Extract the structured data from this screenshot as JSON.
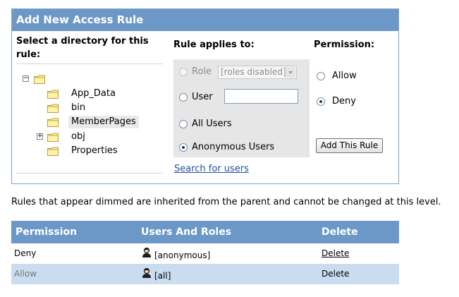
{
  "panel": {
    "title": "Add New Access Rule",
    "directory": {
      "title": "Select a directory for this rule:",
      "tree": [
        {
          "label": "",
          "expand": "minus"
        },
        {
          "label": "App_Data"
        },
        {
          "label": "bin"
        },
        {
          "label": "MemberPages",
          "selected": true
        },
        {
          "label": "obj",
          "expand": "plus"
        },
        {
          "label": "Properties"
        }
      ]
    },
    "rule": {
      "title": "Rule applies to:",
      "role_label": "Role",
      "role_select_value": "[roles disabled]",
      "user_label": "User",
      "user_value": "",
      "all_users_label": "All Users",
      "anonymous_label": "Anonymous Users",
      "selected": "Anonymous Users",
      "search_link": "Search for users"
    },
    "permission": {
      "title": "Permission:",
      "allow_label": "Allow",
      "deny_label": "Deny",
      "selected": "Deny",
      "add_button": "Add This Rule"
    }
  },
  "note": "Rules that appear dimmed are inherited from the parent and cannot be changed at this level.",
  "grid": {
    "headers": [
      "Permission",
      "Users And Roles",
      "Delete"
    ],
    "rows": [
      {
        "permission": "Deny",
        "users": "[anonymous]",
        "delete": "Delete",
        "dimmed": false
      },
      {
        "permission": "Allow",
        "users": "[all]",
        "delete": "Delete",
        "dimmed": true
      }
    ]
  },
  "colors": {
    "header": "#6c98c8",
    "dimmed_row": "#c9dcf0",
    "link": "#1f4f9a"
  }
}
